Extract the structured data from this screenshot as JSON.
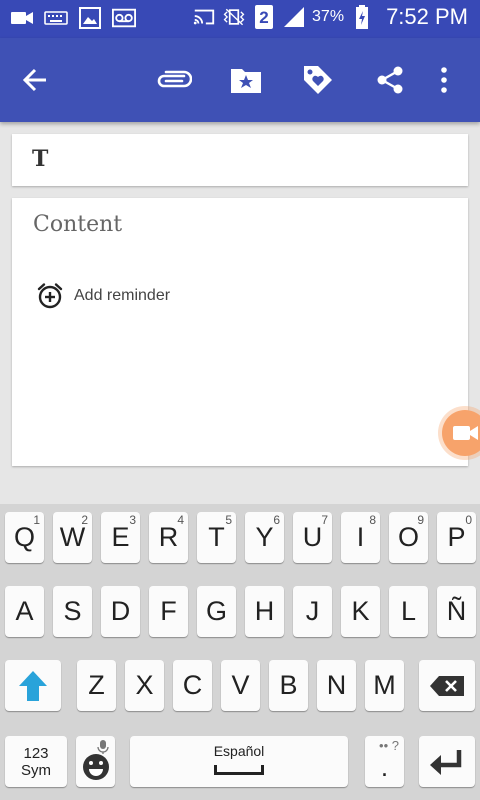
{
  "status_bar": {
    "battery": "37%",
    "time": "7:52 PM",
    "sim_badge": "2",
    "icons": [
      "video-camera-icon",
      "keyboard-icon",
      "image-icon",
      "voicemail-icon",
      "cast-icon",
      "vibrate-icon",
      "sim-icon",
      "signal-icon",
      "battery-charging-icon"
    ]
  },
  "app_bar": {
    "icons": [
      "back-arrow-icon",
      "attachment-icon",
      "folder-star-icon",
      "tag-heart-icon",
      "share-icon",
      "more-vert-icon"
    ]
  },
  "note": {
    "title": "T",
    "content_placeholder": "Content",
    "reminder_label": "Add reminder"
  },
  "keyboard": {
    "row1": [
      {
        "key": "Q",
        "hint": "1"
      },
      {
        "key": "W",
        "hint": "2"
      },
      {
        "key": "E",
        "hint": "3"
      },
      {
        "key": "R",
        "hint": "4"
      },
      {
        "key": "T",
        "hint": "5"
      },
      {
        "key": "Y",
        "hint": "6"
      },
      {
        "key": "U",
        "hint": "7"
      },
      {
        "key": "I",
        "hint": "8"
      },
      {
        "key": "O",
        "hint": "9"
      },
      {
        "key": "P",
        "hint": "0"
      }
    ],
    "row2": [
      "A",
      "S",
      "D",
      "F",
      "G",
      "H",
      "J",
      "K",
      "L",
      "Ñ"
    ],
    "row3": [
      "Z",
      "X",
      "C",
      "V",
      "B",
      "N",
      "M"
    ],
    "sym_line1": "123",
    "sym_line2": "Sym",
    "space_label": "Español",
    "period": ".",
    "period_hint": "•• ?",
    "colors": {
      "shift_active": "#29a3da",
      "accent": "#3f51b5"
    }
  }
}
